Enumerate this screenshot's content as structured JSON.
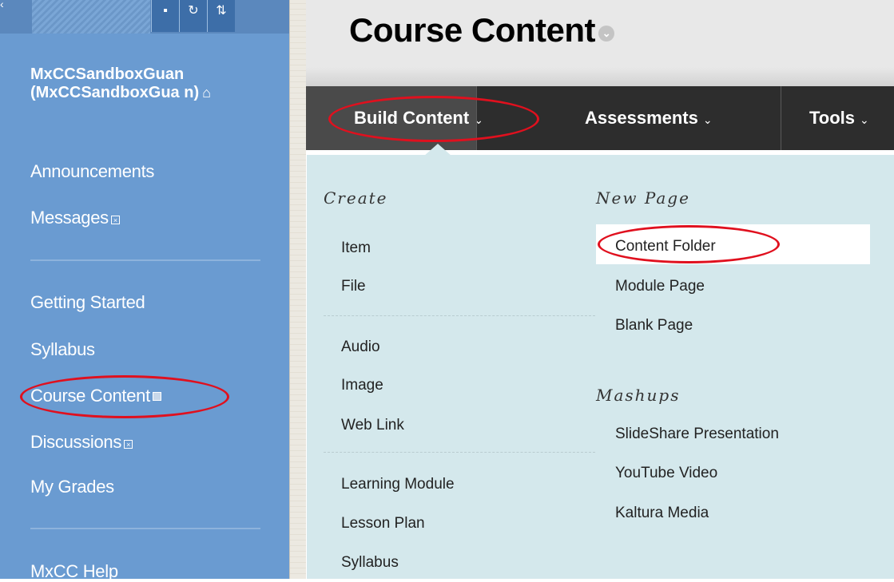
{
  "sidebar": {
    "course_title": "MxCCSandboxGuan (MxCCSandboxGua n)",
    "items": [
      {
        "label": "Announcements"
      },
      {
        "label": "Messages"
      },
      {
        "label": "Getting Started"
      },
      {
        "label": "Syllabus"
      },
      {
        "label": "Course Content"
      },
      {
        "label": "Discussions"
      },
      {
        "label": "My Grades"
      },
      {
        "label": "MxCC Help"
      }
    ]
  },
  "header": {
    "title": "Course Content"
  },
  "action_bar": {
    "build_content": "Build Content",
    "assessments": "Assessments",
    "tools": "Tools"
  },
  "dropdown": {
    "create_heading": "Create",
    "create_items_1": [
      "Item",
      "File"
    ],
    "create_items_2": [
      "Audio",
      "Image",
      "Web Link"
    ],
    "create_items_3": [
      "Learning Module",
      "Lesson Plan",
      "Syllabus"
    ],
    "new_page_heading": "New Page",
    "new_page_items": [
      "Content Folder",
      "Module Page",
      "Blank Page"
    ],
    "mashups_heading": "Mashups",
    "mashups_items": [
      "SlideShare Presentation",
      "YouTube Video",
      "Kaltura Media"
    ]
  },
  "colors": {
    "sidebar_bg": "#6a9bd1",
    "action_bar_bg": "#2d2d2d",
    "dropdown_bg": "#d4e8ec",
    "annotation_red": "#e0101e"
  },
  "icons": {
    "home": "home-icon",
    "refresh": "refresh-icon",
    "sort": "sort-icon",
    "menu_toggle": "window-icon",
    "chevron": "chevron-down-icon"
  }
}
